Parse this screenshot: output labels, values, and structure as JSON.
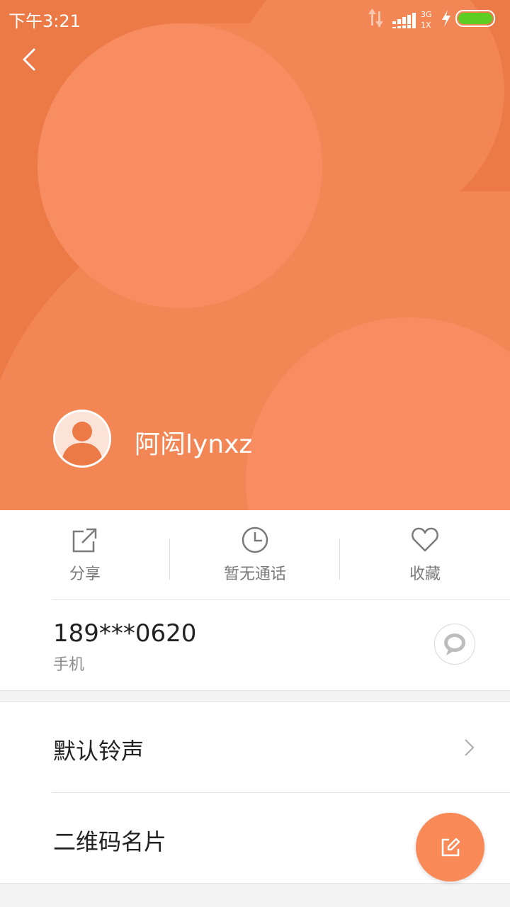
{
  "status_bar": {
    "time": "下午3:21",
    "network_type": "3G",
    "network_sub": "1X",
    "icons": [
      "data-transfer-icon",
      "signal-icon",
      "charging-icon",
      "battery-icon"
    ]
  },
  "header": {
    "background_color": "#ec7a47",
    "back_icon": "chevron-left-icon",
    "contact_name": "阿闳lynxz",
    "avatar_icon": "person-silhouette-icon"
  },
  "actions": [
    {
      "label": "分享",
      "icon": "share-icon"
    },
    {
      "label": "暂无通话",
      "icon": "clock-icon"
    },
    {
      "label": "收藏",
      "icon": "heart-icon"
    }
  ],
  "phone": {
    "number": "189***0620",
    "type": "手机",
    "message_icon": "chat-bubble-icon"
  },
  "list_items": [
    {
      "label": "默认铃声",
      "icon": "chevron-right-icon"
    },
    {
      "label": "二维码名片"
    }
  ],
  "fab": {
    "icon": "edit-icon",
    "color": "#f98a58"
  }
}
